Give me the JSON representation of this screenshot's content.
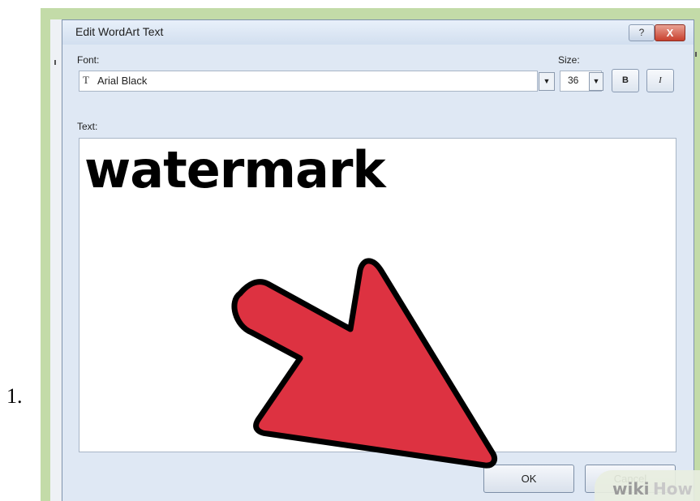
{
  "step": {
    "number": "1."
  },
  "dialog": {
    "title": "Edit WordArt Text",
    "help_label": "?",
    "close_label": "X",
    "font_label": "Font:",
    "font_value": "Arial Black",
    "size_label": "Size:",
    "size_value": "36",
    "bold_label": "B",
    "italic_label": "I",
    "text_label": "Text:",
    "text_value": "watermark",
    "ok_label": "OK",
    "cancel_label": "Cancel"
  },
  "watermark": {
    "part1": "wiki",
    "part2": "How"
  },
  "colors": {
    "arrow": "#dd3241",
    "frame": "#c3dba8",
    "dialog_bg": "#dfe8f4"
  },
  "icons": [
    "font-type-icon",
    "dropdown-arrow-icon",
    "pointer-arrow-icon"
  ]
}
